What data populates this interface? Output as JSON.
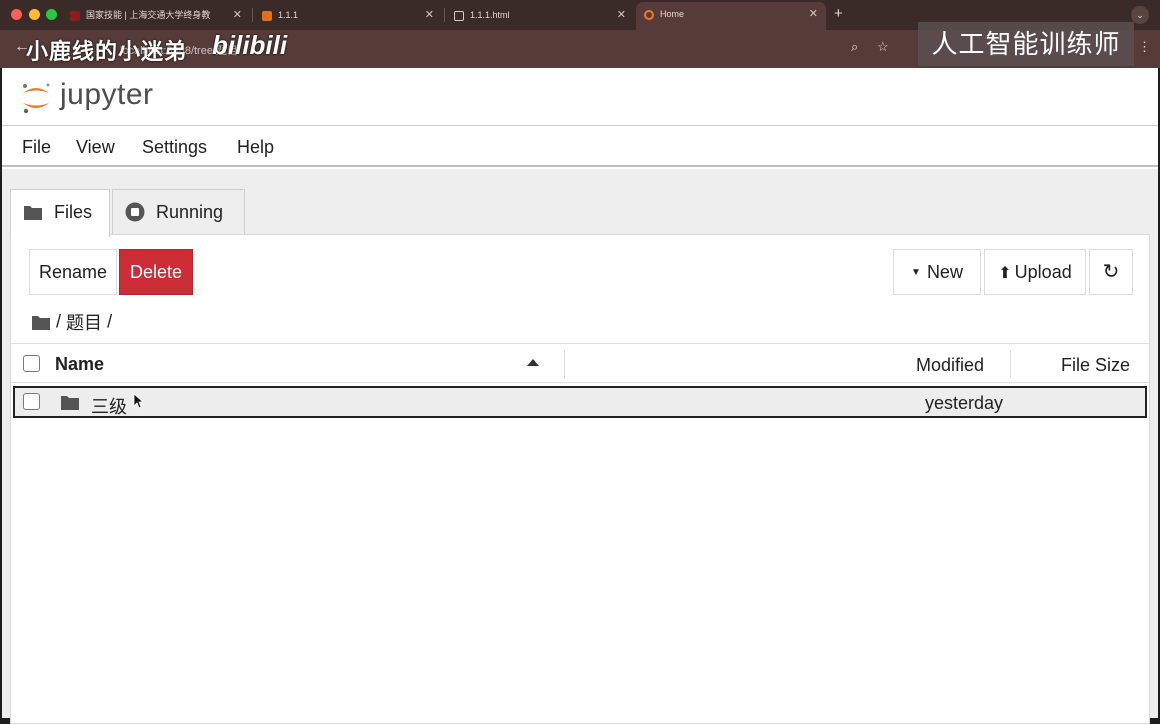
{
  "browser": {
    "tabs": [
      {
        "title": "国家技能 | 上海交通大学终身教"
      },
      {
        "title": "1.1.1"
      },
      {
        "title": "1.1.1.html"
      },
      {
        "title": "Home"
      }
    ],
    "url": "localhost:8888/tree/题目",
    "watermark_left": "小鹿线的小迷弟",
    "watermark_bili": "bilibili",
    "watermark_right": "人工智能训练师"
  },
  "jupyter": {
    "logo_text": "jupyter",
    "menu": [
      "File",
      "View",
      "Settings",
      "Help"
    ],
    "tabs": [
      {
        "label": "Files",
        "icon": "folder-icon",
        "active": true
      },
      {
        "label": "Running",
        "icon": "stop-circle-icon",
        "active": false
      }
    ],
    "actions": {
      "rename": "Rename",
      "delete": "Delete",
      "new": "New",
      "upload": "Upload"
    },
    "breadcrumb": {
      "sep1": "/",
      "folder": "题目",
      "sep2": "/"
    },
    "list_header": {
      "name": "Name",
      "modified": "Modified",
      "file_size": "File Size"
    },
    "rows": [
      {
        "name": "三级",
        "modified": "yesterday",
        "type": "folder",
        "selected": true
      }
    ]
  },
  "colors": {
    "delete_red": "#cc2c35",
    "jupyter_orange": "#f37726",
    "browser_bar": "#563b38"
  }
}
